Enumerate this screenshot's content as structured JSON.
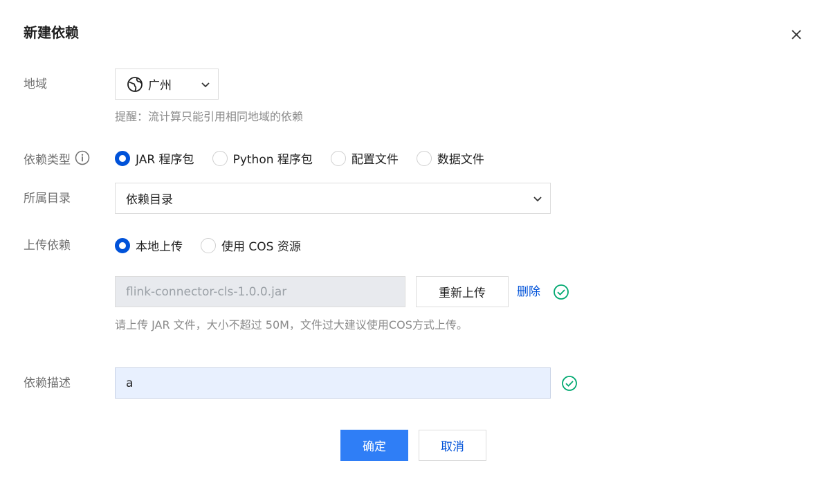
{
  "dialog": {
    "title": "新建依赖"
  },
  "region": {
    "label": "地域",
    "value": "广州",
    "hint": "提醒：流计算只能引用相同地域的依赖"
  },
  "dep_type": {
    "label": "依赖类型",
    "options": [
      "JAR 程序包",
      "Python 程序包",
      "配置文件",
      "数据文件"
    ],
    "selected_index": 0
  },
  "directory": {
    "label": "所属目录",
    "value": "依赖目录"
  },
  "upload": {
    "label": "上传依赖",
    "options": [
      "本地上传",
      "使用 COS 资源"
    ],
    "selected_index": 0,
    "file_name": "flink-connector-cls-1.0.0.jar",
    "reupload_label": "重新上传",
    "delete_label": "删除",
    "hint": "请上传 JAR 文件，大小不超过 50M，文件过大建议使用COS方式上传。"
  },
  "description": {
    "label": "依赖描述",
    "value": "a"
  },
  "footer": {
    "confirm_label": "确定",
    "cancel_label": "取消"
  },
  "colors": {
    "primary": "#0052d9",
    "success": "#00a870",
    "button_primary": "#2f7ef6"
  },
  "icons": {
    "close": "close-icon",
    "globe": "globe-icon",
    "chevron": "chevron-down-icon",
    "info": "info-circle-icon",
    "success": "check-circle-icon"
  }
}
